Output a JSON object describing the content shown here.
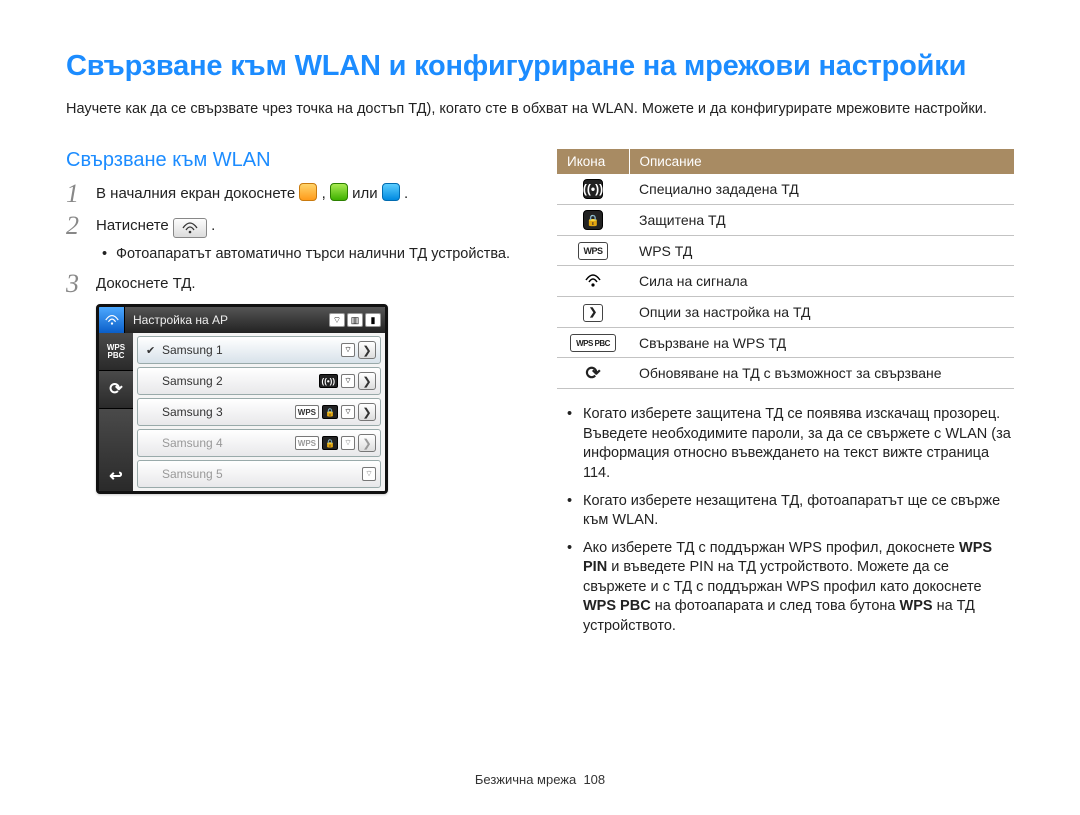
{
  "title": "Свързване към WLAN и конфигуриране на мрежови настройки",
  "intro": "Научете как да се свързвате чрез точка на достъп ТД), когато сте в обхват на WLAN. Можете и да конфигурирате мрежовите настройки.",
  "subhead": "Свързване към WLAN",
  "steps": {
    "s1_a": "В началния екран докоснете ",
    "s1_b": ", ",
    "s1_c": " или ",
    "s1_d": " .",
    "s2_a": "Натиснете ",
    "s2_b": " .",
    "s2_sub": "Фотоапаратът автоматично търси налични ТД устройства.",
    "s3": "Докоснете ТД."
  },
  "mock": {
    "title": "Настройка на AP",
    "rows": [
      {
        "name": "Samsung 1",
        "checked": true,
        "badges": [
          "wifi"
        ],
        "arrow": true,
        "dim": false
      },
      {
        "name": "Samsung 2",
        "checked": false,
        "badges": [
          "beacon",
          "wifi"
        ],
        "arrow": true,
        "dim": false
      },
      {
        "name": "Samsung 3",
        "checked": false,
        "badges": [
          "wps",
          "lock",
          "wifi"
        ],
        "arrow": true,
        "dim": false
      },
      {
        "name": "Samsung 4",
        "checked": false,
        "badges": [
          "wps",
          "lock",
          "wifi"
        ],
        "arrow": true,
        "dim": true
      },
      {
        "name": "Samsung 5",
        "checked": false,
        "badges": [
          "wifi"
        ],
        "arrow": false,
        "dim": true
      }
    ],
    "side": [
      "WPS\nPBC",
      "⟳",
      "↩"
    ]
  },
  "table": {
    "head_icon": "Икона",
    "head_desc": "Описание",
    "rows": [
      {
        "icon": "beacon",
        "desc": "Специално зададена ТД"
      },
      {
        "icon": "lock",
        "desc": "Защитена ТД"
      },
      {
        "icon": "wps",
        "desc": "WPS ТД"
      },
      {
        "icon": "wifi",
        "desc": "Сила на сигнала"
      },
      {
        "icon": "arrow",
        "desc": "Опции за настройка на ТД"
      },
      {
        "icon": "wpspbc",
        "desc": "Свързване на WPS ТД"
      },
      {
        "icon": "refresh",
        "desc": "Обновяване на ТД с възможност за свързване"
      }
    ]
  },
  "notes": {
    "n1": "Когато изберете защитена ТД се появява изскачащ прозорец. Въведете необходимите пароли, за да се свържете с WLAN (за информация относно въвеждането на текст вижте страница 114.",
    "n2": "Когато изберете незащитена ТД, фотоапаратът ще се свърже към WLAN.",
    "n3_a": "Ако изберете ТД с поддържан WPS профил, докоснете ",
    "n3_b1": "WPS PIN",
    "n3_c": " и въведете PIN на ТД устройството. Можете да се свържете и с ТД с поддържан WPS профил като докоснете ",
    "n3_b2": "WPS PBC",
    "n3_d": " на фотоапарата и след това бутона ",
    "n3_b3": "WPS",
    "n3_e": " на ТД устройството."
  },
  "footer": {
    "section": "Безжична мрежа",
    "page": "108"
  }
}
